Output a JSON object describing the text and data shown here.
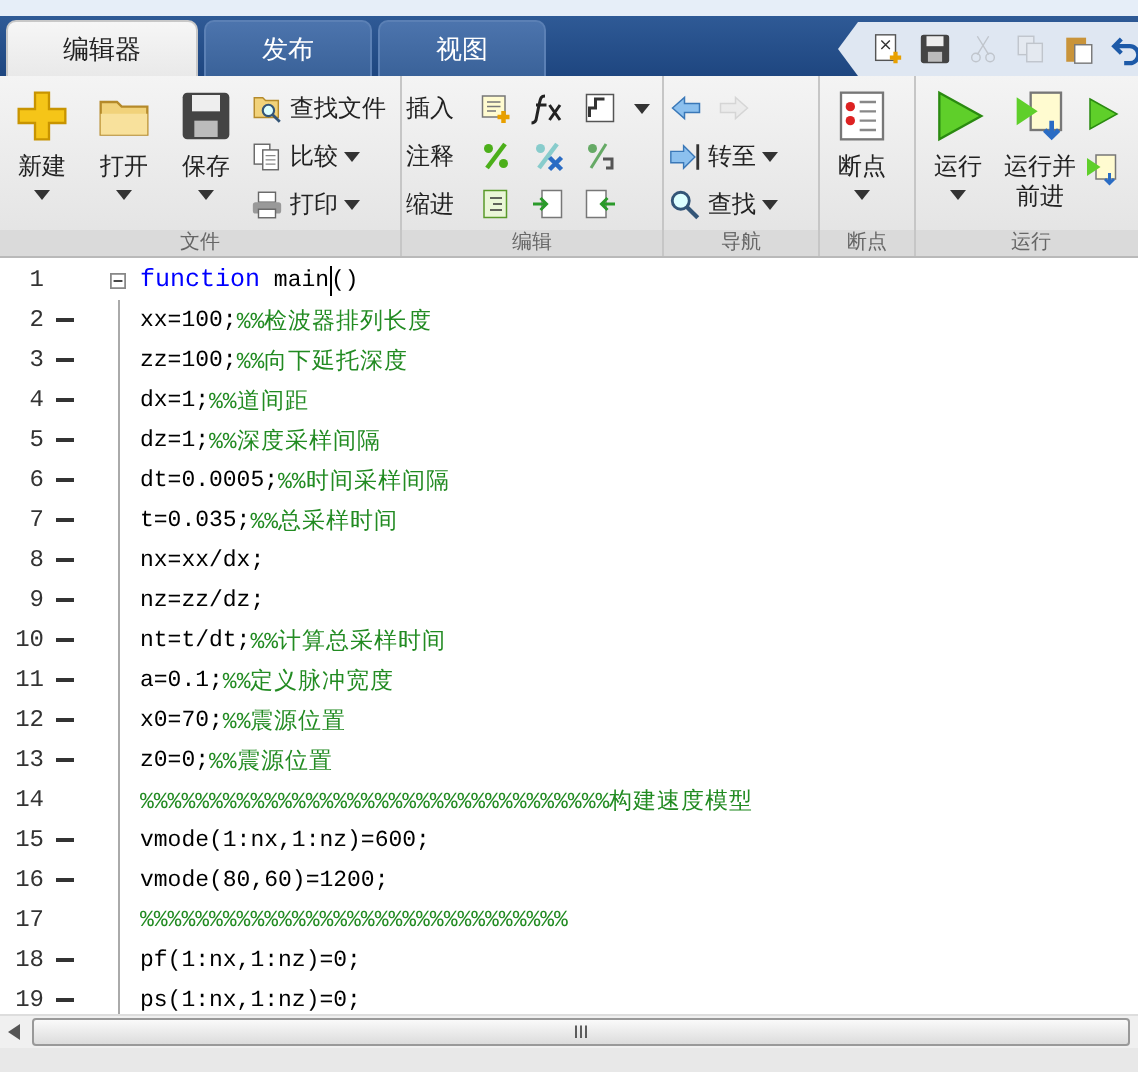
{
  "tabs": [
    {
      "label": "编辑器",
      "selected": true
    },
    {
      "label": "发布",
      "selected": false
    },
    {
      "label": "视图",
      "selected": false
    }
  ],
  "quick_access": [
    {
      "disabled": false
    },
    {
      "disabled": false
    },
    {
      "disabled": true
    },
    {
      "disabled": true
    },
    {
      "disabled": false
    },
    {
      "disabled": false
    }
  ],
  "ribbon": [
    {
      "label": "文件",
      "items": [
        {
          "kind": "large",
          "label": "新建",
          "dropdown": true
        },
        {
          "kind": "large",
          "label": "打开",
          "dropdown": true
        },
        {
          "kind": "large",
          "label": "保存",
          "dropdown": true
        },
        {
          "kind": "small",
          "label": "查找文件",
          "dropdown": false
        },
        {
          "kind": "small",
          "label": "比较",
          "dropdown": true
        },
        {
          "kind": "small",
          "label": "打印",
          "dropdown": true
        }
      ]
    },
    {
      "label": "编辑",
      "items": [
        {
          "kind": "row",
          "label": "插入",
          "dropdown": true
        },
        {
          "kind": "row",
          "label": "注释",
          "dropdown": false
        },
        {
          "kind": "row",
          "label": "缩进",
          "dropdown": false
        }
      ]
    },
    {
      "label": "导航",
      "items": [
        {
          "kind": "arrows",
          "forward_disabled": true
        },
        {
          "kind": "small",
          "label": "转至",
          "dropdown": true
        },
        {
          "kind": "small",
          "label": "查找",
          "dropdown": true
        }
      ]
    },
    {
      "label": "断点",
      "items": [
        {
          "kind": "large",
          "label": "断点",
          "dropdown": true
        }
      ]
    },
    {
      "label": "运行",
      "items": [
        {
          "kind": "large",
          "label": "运行",
          "dropdown": true
        },
        {
          "kind": "large",
          "label": "运行并前进",
          "dropdown": false
        },
        {
          "kind": "column"
        }
      ]
    }
  ],
  "lines": [
    {
      "number": "1",
      "dash": false,
      "fold": true,
      "segments": [
        {
          "kind": "keyword",
          "text": "function"
        },
        {
          "kind": "code",
          "text": " main"
        },
        {
          "kind": "cursor"
        },
        {
          "kind": "code",
          "text": "()"
        }
      ]
    },
    {
      "number": "2",
      "dash": true,
      "fold": false,
      "segments": [
        {
          "kind": "code",
          "text": "xx=100;"
        },
        {
          "kind": "comment",
          "text": "%%检波器排列长度"
        }
      ]
    },
    {
      "number": "3",
      "dash": true,
      "fold": false,
      "segments": [
        {
          "kind": "code",
          "text": "zz=100;"
        },
        {
          "kind": "comment",
          "text": "%%向下延托深度"
        }
      ]
    },
    {
      "number": "4",
      "dash": true,
      "fold": false,
      "segments": [
        {
          "kind": "code",
          "text": "dx=1;"
        },
        {
          "kind": "comment",
          "text": "%%道间距"
        }
      ]
    },
    {
      "number": "5",
      "dash": true,
      "fold": false,
      "segments": [
        {
          "kind": "code",
          "text": "dz=1;"
        },
        {
          "kind": "comment",
          "text": "%%深度采样间隔"
        }
      ]
    },
    {
      "number": "6",
      "dash": true,
      "fold": false,
      "segments": [
        {
          "kind": "code",
          "text": "dt=0.0005;"
        },
        {
          "kind": "comment",
          "text": "%%时间采样间隔"
        }
      ]
    },
    {
      "number": "7",
      "dash": true,
      "fold": false,
      "segments": [
        {
          "kind": "code",
          "text": "t=0.035;"
        },
        {
          "kind": "comment",
          "text": "%%总采样时间"
        }
      ]
    },
    {
      "number": "8",
      "dash": true,
      "fold": false,
      "segments": [
        {
          "kind": "code",
          "text": "nx=xx/dx;"
        }
      ]
    },
    {
      "number": "9",
      "dash": true,
      "fold": false,
      "segments": [
        {
          "kind": "code",
          "text": "nz=zz/dz;"
        }
      ]
    },
    {
      "number": "10",
      "dash": true,
      "fold": false,
      "segments": [
        {
          "kind": "code",
          "text": "nt=t/dt;"
        },
        {
          "kind": "comment",
          "text": "%%计算总采样时间"
        }
      ]
    },
    {
      "number": "11",
      "dash": true,
      "fold": false,
      "segments": [
        {
          "kind": "code",
          "text": "a=0.1;"
        },
        {
          "kind": "comment",
          "text": "%%定义脉冲宽度"
        }
      ]
    },
    {
      "number": "12",
      "dash": true,
      "fold": false,
      "segments": [
        {
          "kind": "code",
          "text": "x0=70;"
        },
        {
          "kind": "comment",
          "text": "%%震源位置"
        }
      ]
    },
    {
      "number": "13",
      "dash": true,
      "fold": false,
      "segments": [
        {
          "kind": "code",
          "text": "z0=0;"
        },
        {
          "kind": "comment",
          "text": "%%震源位置"
        }
      ]
    },
    {
      "number": "14",
      "dash": false,
      "fold": false,
      "segments": [
        {
          "kind": "comment",
          "text": "%%%%%%%%%%%%%%%%%%%%%%%%%%%%%%%%%%构建速度模型"
        }
      ]
    },
    {
      "number": "15",
      "dash": true,
      "fold": false,
      "segments": [
        {
          "kind": "code",
          "text": "vmode(1:nx,1:nz)=600;"
        }
      ]
    },
    {
      "number": "16",
      "dash": true,
      "fold": false,
      "segments": [
        {
          "kind": "code",
          "text": "vmode(80,60)=1200;"
        }
      ]
    },
    {
      "number": "17",
      "dash": false,
      "fold": false,
      "segments": [
        {
          "kind": "comment",
          "text": "%%%%%%%%%%%%%%%%%%%%%%%%%%%%%%%"
        }
      ]
    },
    {
      "number": "18",
      "dash": true,
      "fold": false,
      "segments": [
        {
          "kind": "code",
          "text": "pf(1:nx,1:nz)=0;"
        }
      ]
    },
    {
      "number": "19",
      "dash": true,
      "fold": false,
      "segments": [
        {
          "kind": "code",
          "text": "ps(1:nx,1:nz)=0;"
        }
      ]
    }
  ],
  "scrollbar": {
    "thumb_grip": "III"
  }
}
